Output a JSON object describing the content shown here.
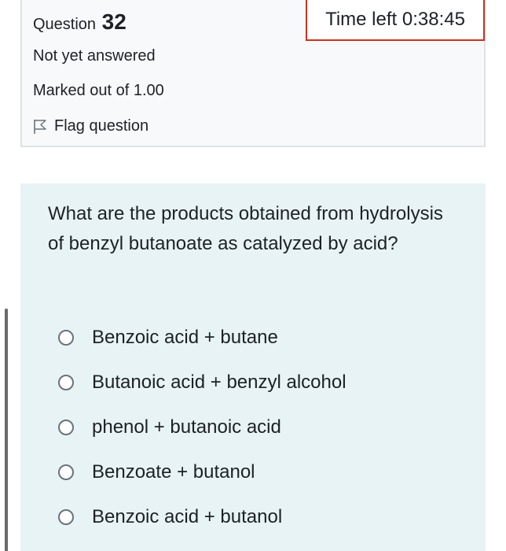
{
  "question_info": {
    "label": "Question",
    "number": "32",
    "status": "Not yet answered",
    "marked": "Marked out of 1.00",
    "flag_label": "Flag question"
  },
  "timer": {
    "text": "Time left 0:38:45"
  },
  "question": {
    "text": "What are the products obtained from hydrolysis of benzyl butanoate as catalyzed by acid?",
    "answers": [
      {
        "label": "Benzoic acid + butane"
      },
      {
        "label": "Butanoic acid + benzyl alcohol"
      },
      {
        "label": "phenol + butanoic acid"
      },
      {
        "label": "Benzoate + butanol"
      },
      {
        "label": "Benzoic acid + butanol"
      }
    ]
  },
  "colors": {
    "info_background": "#f8f9fa",
    "question_background": "#e7f3f5",
    "timer_border": "#ca3120"
  }
}
